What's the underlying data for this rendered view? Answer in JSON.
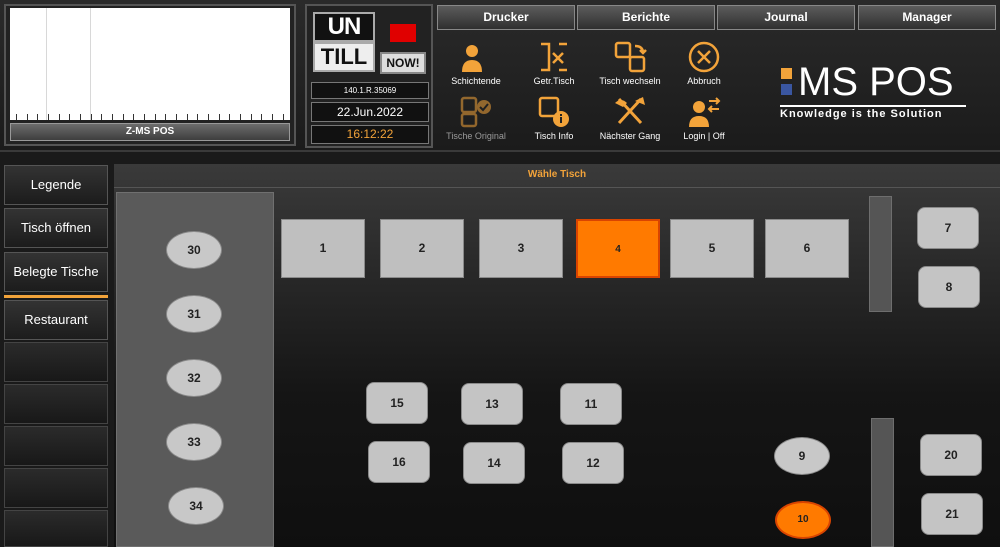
{
  "zpanel": {
    "button_label": "Z-MS POS"
  },
  "untill": {
    "logo_top": "UN",
    "logo_bottom": "TILL",
    "now_label": "NOW!",
    "version": "140.1.R.35069",
    "date": "22.Jun.2022",
    "time": "16:12:22"
  },
  "menu": [
    {
      "label": "Drucker"
    },
    {
      "label": "Berichte"
    },
    {
      "label": "Journal"
    },
    {
      "label": "Manager"
    }
  ],
  "actions": [
    {
      "label": "Schichtende",
      "icon": "shift-end-icon"
    },
    {
      "label": "Getr.Tisch",
      "icon": "separate-table-icon"
    },
    {
      "label": "Tisch wechseln",
      "icon": "change-table-icon"
    },
    {
      "label": "Abbruch",
      "icon": "cancel-icon"
    },
    {
      "label": "Tische Original",
      "icon": "original-tables-icon"
    },
    {
      "label": "Tisch Info",
      "icon": "table-info-icon"
    },
    {
      "label": "Nächster Gang",
      "icon": "next-course-icon"
    },
    {
      "label": "Login | Off",
      "icon": "login-off-icon"
    }
  ],
  "brand": {
    "name": "MS POS",
    "tagline": "Knowledge is the Solution"
  },
  "sidebar": [
    {
      "label": "Legende"
    },
    {
      "label": "Tisch öffnen"
    },
    {
      "label": "Belegte Tische"
    },
    {
      "label": "Restaurant"
    }
  ],
  "main": {
    "title": "Wähle Tisch",
    "tables": {
      "t1": "1",
      "t2": "2",
      "t3": "3",
      "t4": "4",
      "t5": "5",
      "t6": "6",
      "t7": "7",
      "t8": "8",
      "t9": "9",
      "t10": "10",
      "t11": "11",
      "t12": "12",
      "t13": "13",
      "t14": "14",
      "t15": "15",
      "t16": "16",
      "t20": "20",
      "t21": "21",
      "t30": "30",
      "t31": "31",
      "t32": "32",
      "t33": "33",
      "t34": "34"
    },
    "selected_tables": [
      "4",
      "10"
    ]
  },
  "colors": {
    "accent": "#f2a33a",
    "selected": "#ff7a00",
    "table": "#c4c4c4",
    "indicator": "#e00000"
  }
}
